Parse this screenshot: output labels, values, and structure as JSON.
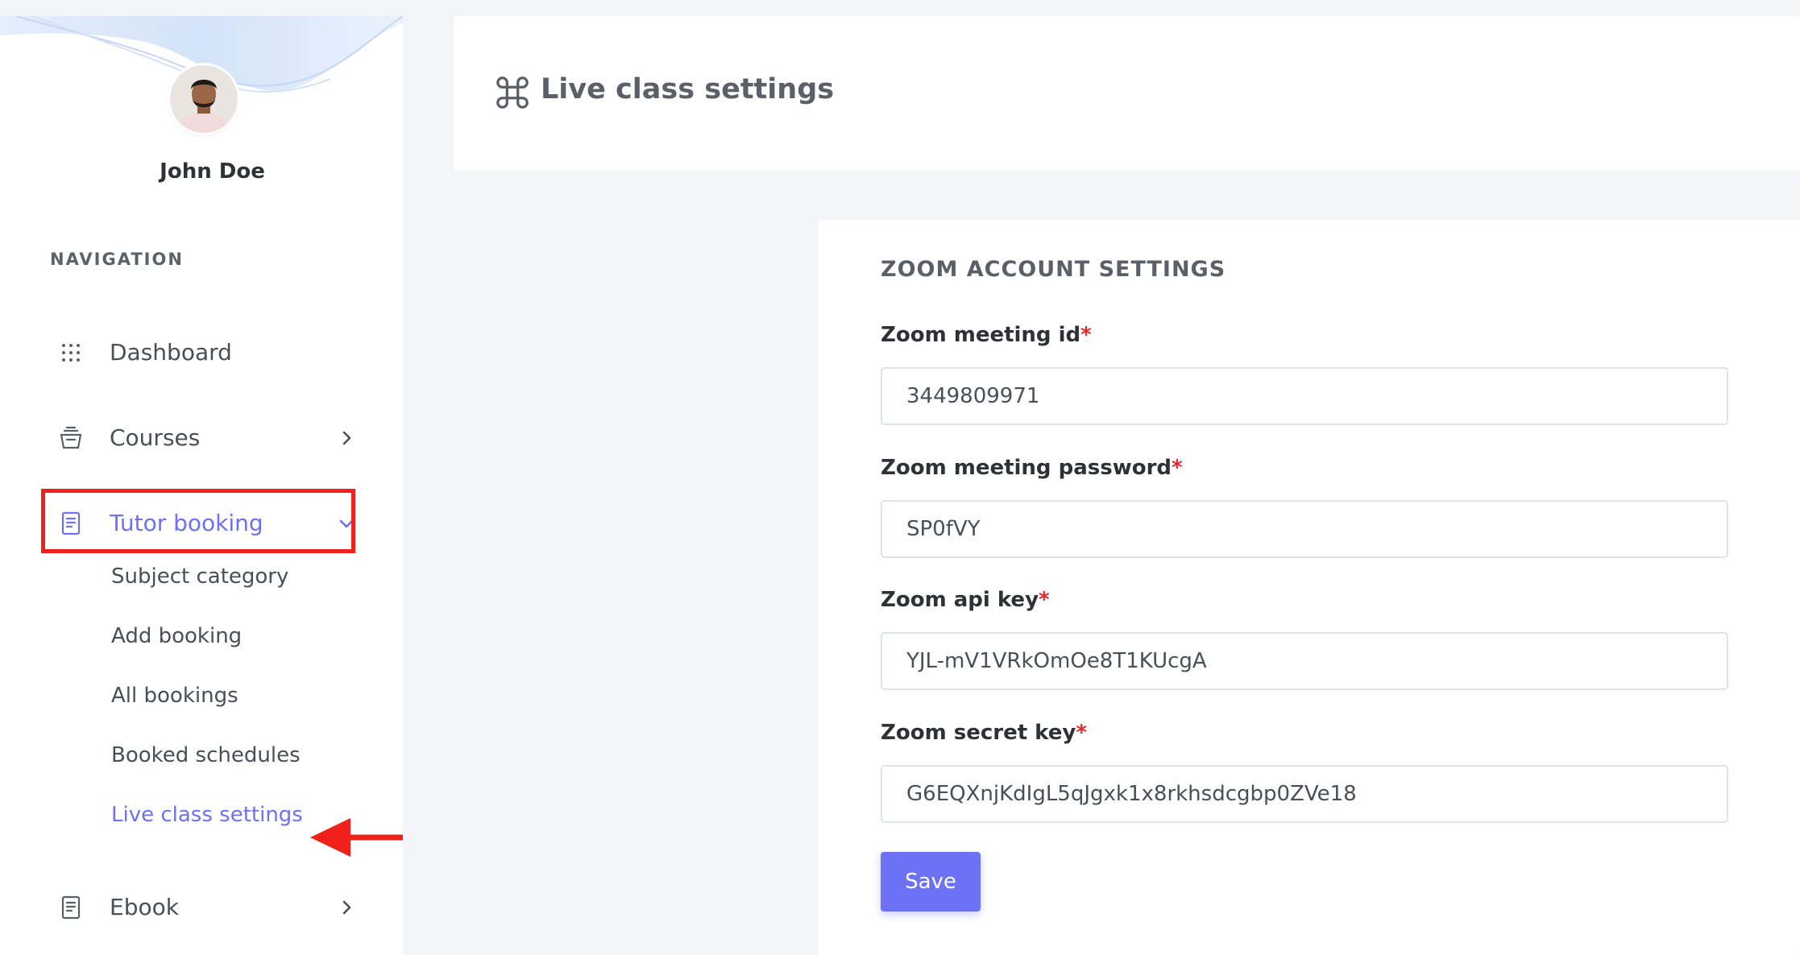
{
  "user": {
    "name": "John Doe"
  },
  "sidebar": {
    "heading": "NAVIGATION",
    "items": [
      {
        "label": "Dashboard",
        "icon": "grid-dots-icon"
      },
      {
        "label": "Courses",
        "icon": "courses-icon"
      },
      {
        "label": "Tutor booking",
        "icon": "document-icon",
        "active": true,
        "expanded": true
      },
      {
        "label": "Ebook",
        "icon": "book-icon"
      }
    ],
    "tutor_submenu": [
      "Subject category",
      "Add booking",
      "All bookings",
      "Booked schedules",
      "Live class settings"
    ],
    "active_submenu": "Live class settings"
  },
  "header": {
    "title": "Live class settings",
    "icon": "command-icon"
  },
  "form": {
    "section_title": "ZOOM ACCOUNT SETTINGS",
    "required_mark": "*",
    "fields": [
      {
        "label": "Zoom meeting id",
        "value": "3449809971"
      },
      {
        "label": "Zoom meeting password",
        "value": "SP0fVY"
      },
      {
        "label": "Zoom api key",
        "value": "YJL-mV1VRkOmOe8T1KUcgA"
      },
      {
        "label": "Zoom secret key",
        "value": "G6EQXnjKdIgL5qJgxk1x8rkhsdcgbp0ZVe18"
      }
    ],
    "save_label": "Save"
  },
  "colors": {
    "accent": "#6c71f5",
    "highlight": "#f0201a",
    "required": "#e8262b"
  }
}
